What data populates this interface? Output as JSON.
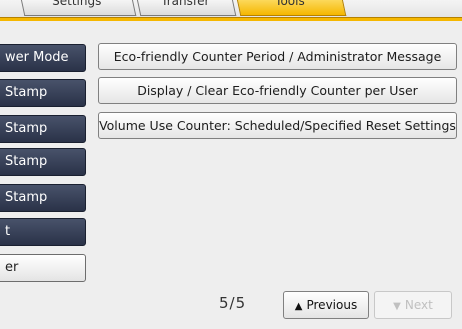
{
  "tabs": [
    {
      "label": "Settings",
      "active": false
    },
    {
      "label": "Transfer",
      "active": false
    },
    {
      "label": "Tools",
      "active": true
    }
  ],
  "left_buttons": [
    {
      "label": "wer Mode",
      "style": "dark"
    },
    {
      "label": "Stamp",
      "style": "dark"
    },
    {
      "label": "Stamp",
      "style": "dark"
    },
    {
      "label": "Stamp",
      "style": "dark"
    },
    {
      "label": "Stamp",
      "style": "dark"
    },
    {
      "label": "t",
      "style": "dark"
    },
    {
      "label": "er",
      "style": "white"
    }
  ],
  "right_buttons": [
    {
      "label": "Eco-friendly Counter Period / Administrator Message"
    },
    {
      "label": "Display / Clear Eco-friendly Counter per User"
    },
    {
      "label": "Volume Use Counter: Scheduled/Specified Reset Settings"
    }
  ],
  "pagination": {
    "text": "5/5",
    "previous_label": "Previous",
    "next_label": "Next",
    "previous_icon": "triangle-up-icon",
    "next_icon": "triangle-down-icon"
  },
  "colors": {
    "active_tab": "#f5b700",
    "dark_button": "#2f374c",
    "background": "#eeeeee"
  }
}
